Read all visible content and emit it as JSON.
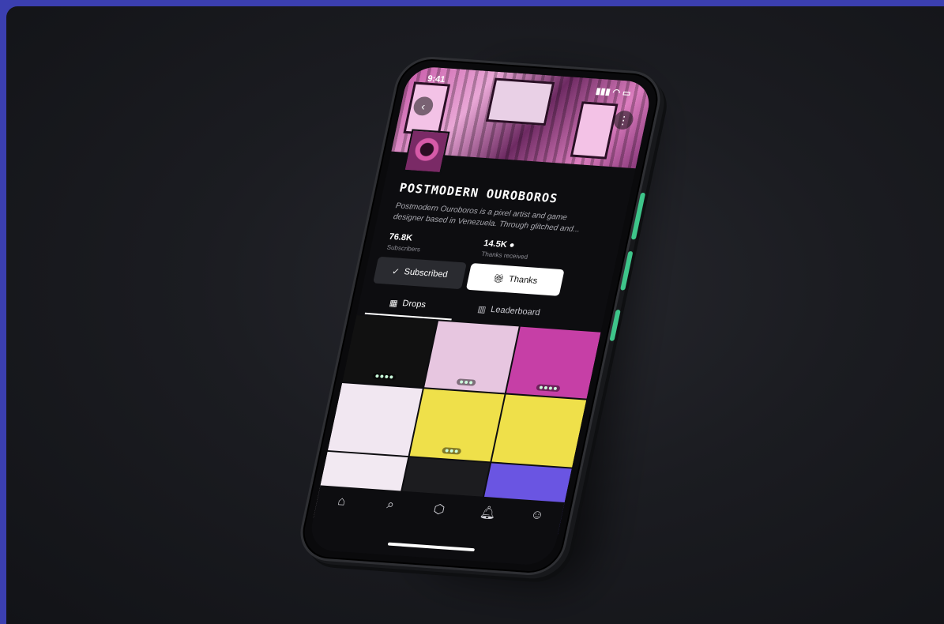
{
  "status": {
    "time": "9:41"
  },
  "profile": {
    "name": "POSTMODERN OUROBOROS",
    "bio": "Postmodern Ouroboros is a pixel artist and game designer based in Venezuela. Through glitched and...",
    "subscribers_count": "76.8K",
    "subscribers_label": "Subscribers",
    "thanks_count": "14.5K",
    "thanks_label": "Thanks received"
  },
  "actions": {
    "subscribed_label": "Subscribed",
    "thanks_label": "Thanks"
  },
  "tabs": [
    {
      "label": "Drops"
    },
    {
      "label": "Leaderboard"
    }
  ],
  "grid_colors": [
    "#111111",
    "#e7c6e0",
    "#c63fa6",
    "#f1e7f1",
    "#efe04a",
    "#efe04a",
    "#f2e9f2",
    "#1c1c1f",
    "#6a55e2"
  ],
  "bottom_nav": [
    "home-icon",
    "search-icon",
    "box-icon",
    "bell-icon",
    "profile-icon"
  ],
  "colors": {
    "accent": "#3ec58a",
    "frame": "#3b3fb0"
  }
}
